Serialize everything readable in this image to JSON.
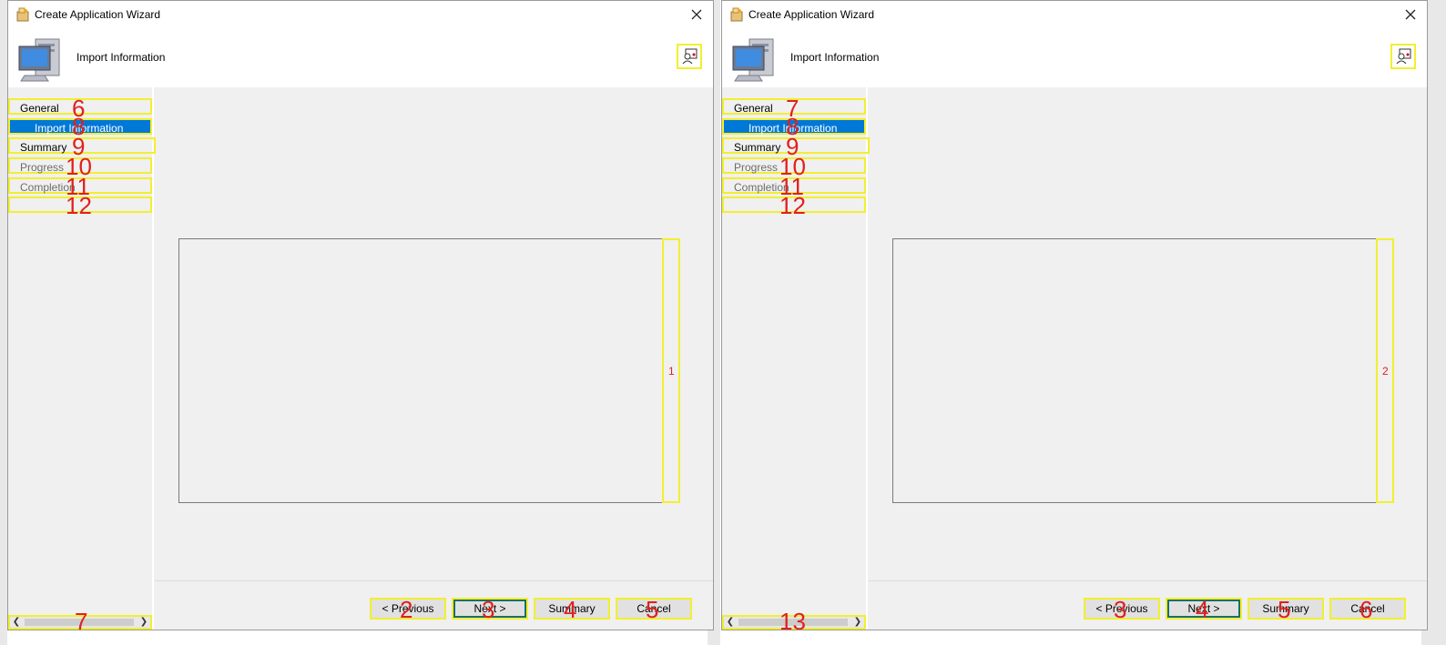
{
  "windows": [
    {
      "title": "Create Application Wizard",
      "header_title": "Import Information",
      "nav": [
        {
          "label": "General",
          "state": "normal",
          "marker": "6"
        },
        {
          "label": "Import Information",
          "state": "active",
          "marker": "8"
        },
        {
          "label": "Summary",
          "state": "normal",
          "marker": "9"
        },
        {
          "label": "Progress",
          "state": "disabled",
          "marker": "10"
        },
        {
          "label": "Completion",
          "state": "disabled",
          "marker": "11"
        },
        {
          "label": "",
          "state": "empty",
          "marker": "12"
        }
      ],
      "scroll_marker": "7",
      "content_marker": "1",
      "buttons": {
        "previous": {
          "label": "< Previous",
          "marker": "2"
        },
        "next": {
          "label": "Next >",
          "marker": "3"
        },
        "summary": {
          "label": "Summary",
          "marker": "4"
        },
        "cancel": {
          "label": "Cancel",
          "marker": "5"
        }
      }
    },
    {
      "title": "Create Application Wizard",
      "header_title": "Import Information",
      "nav": [
        {
          "label": "General",
          "state": "normal",
          "marker": "7"
        },
        {
          "label": "Import Information",
          "state": "active",
          "marker": "8"
        },
        {
          "label": "Summary",
          "state": "normal",
          "marker": "9"
        },
        {
          "label": "Progress",
          "state": "disabled",
          "marker": "10"
        },
        {
          "label": "Completion",
          "state": "disabled",
          "marker": "11"
        },
        {
          "label": "",
          "state": "empty",
          "marker": "12"
        }
      ],
      "scroll_marker": "13",
      "content_marker": "2",
      "buttons": {
        "previous": {
          "label": "< Previous",
          "marker": "3"
        },
        "next": {
          "label": "Next >",
          "marker": "4"
        },
        "summary": {
          "label": "Summary",
          "marker": "5"
        },
        "cancel": {
          "label": "Cancel",
          "marker": "6"
        }
      }
    }
  ],
  "icons": {
    "app": "wizard-app-icon",
    "close": "close-icon",
    "header": "computer-icon",
    "help": "help-person-icon",
    "scroll_left": "chevron-left-icon",
    "scroll_right": "chevron-right-icon"
  },
  "colors": {
    "selection": "#0078d7",
    "annotation_box": "#f2ef2f",
    "annotation_text": "#e0201e"
  }
}
